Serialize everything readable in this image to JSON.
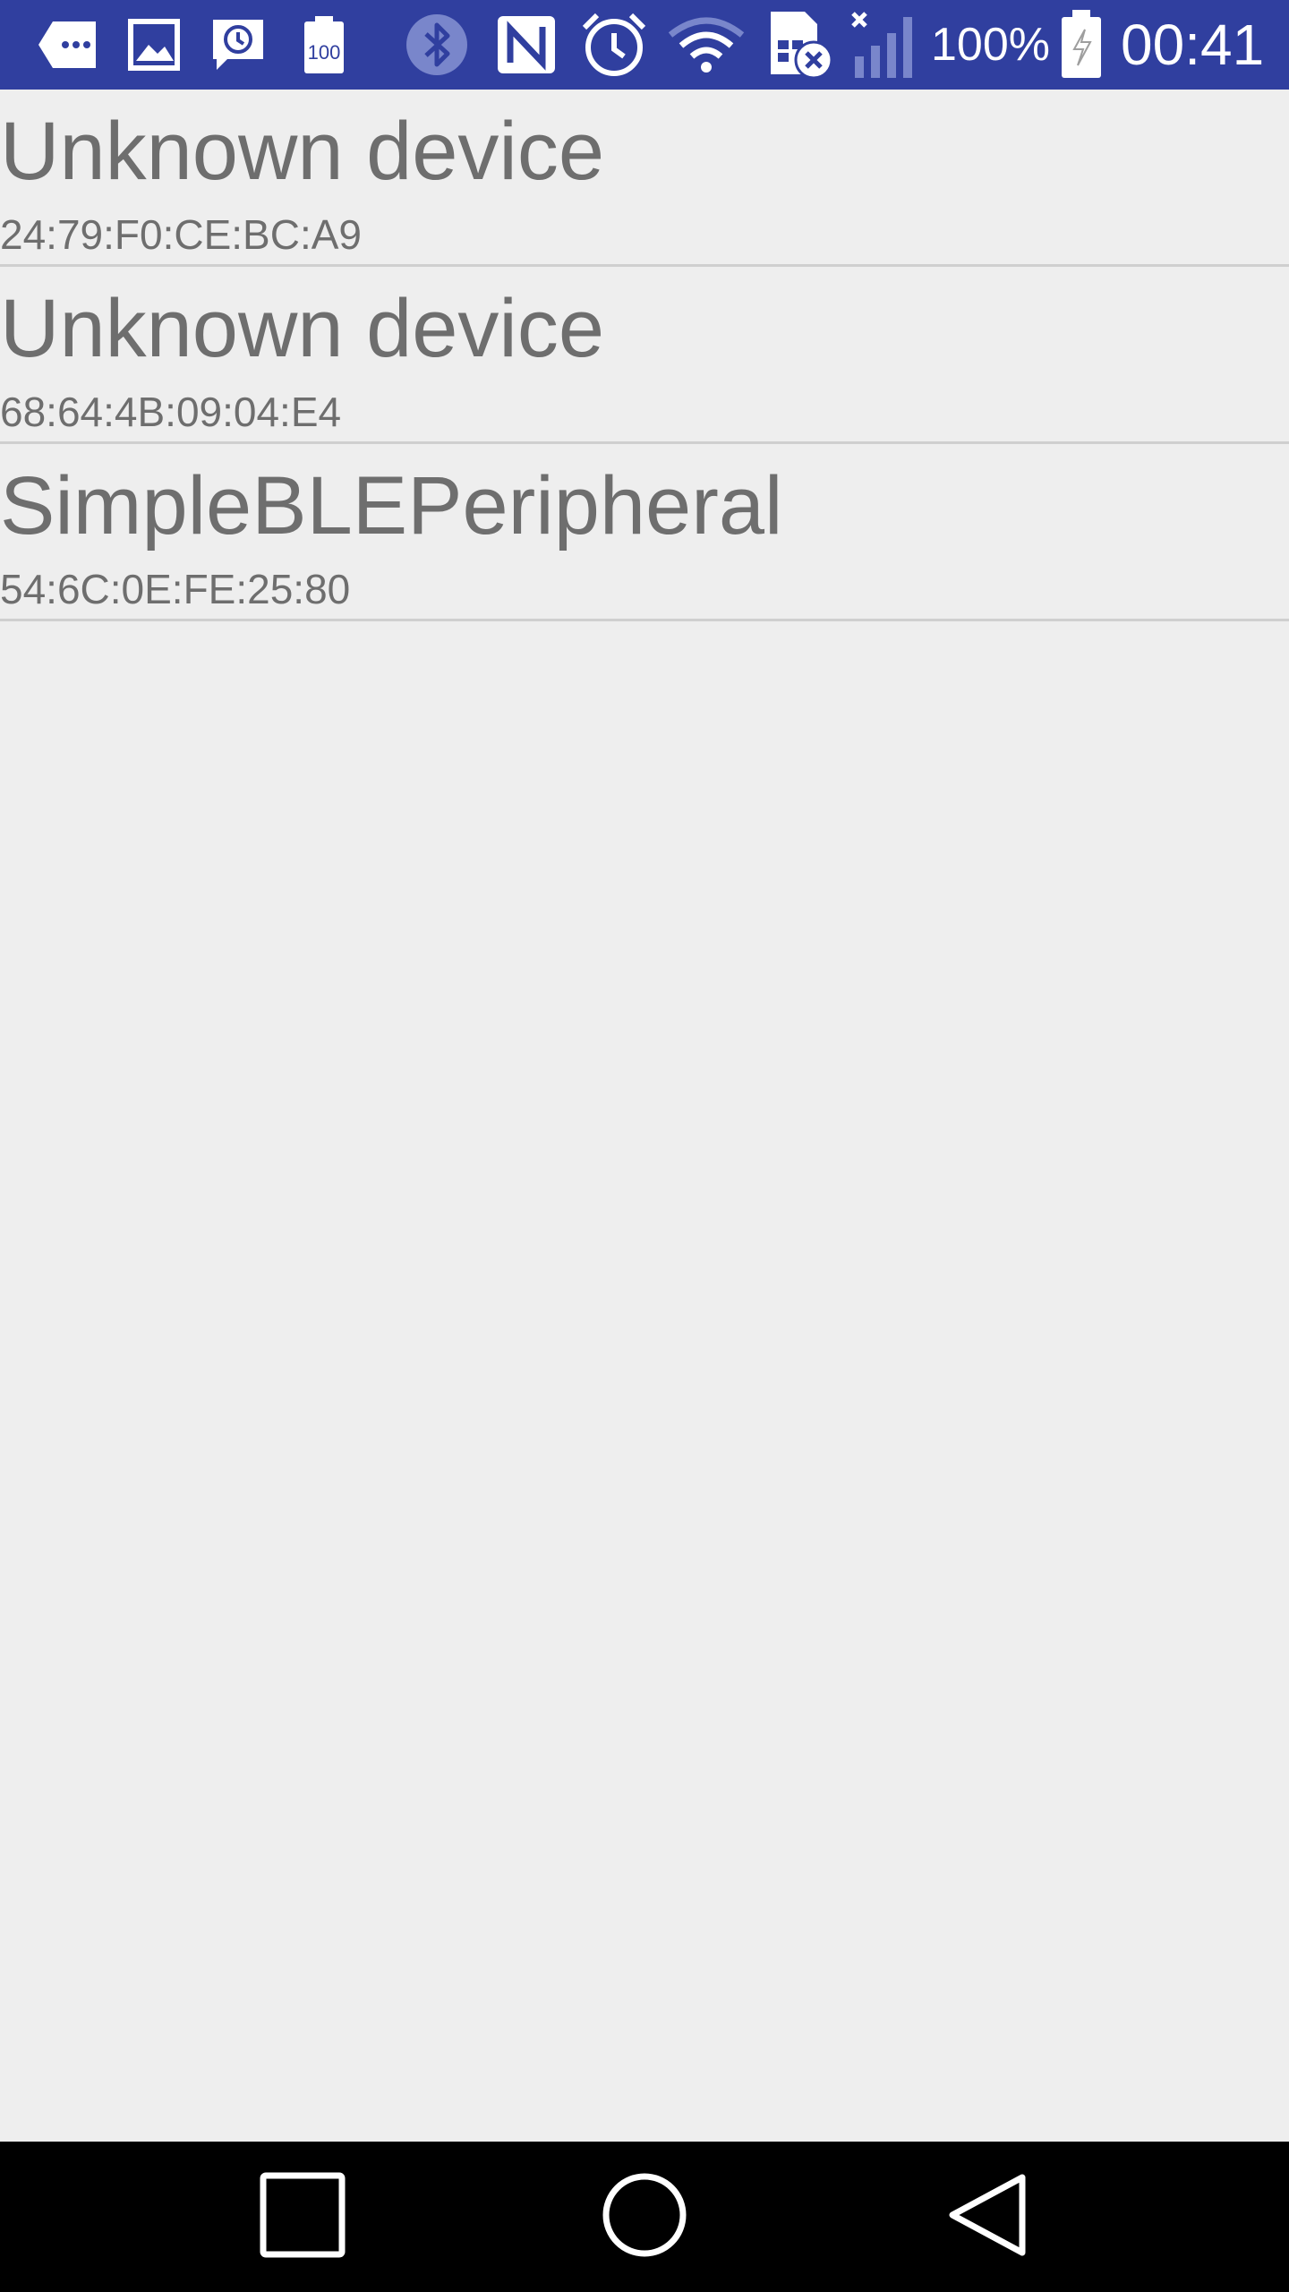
{
  "status_bar": {
    "background": "#303f9f",
    "icons_left": [
      "message-more-icon",
      "image-icon",
      "history-chat-icon",
      "battery-100-icon"
    ],
    "icons_right": [
      "bluetooth-icon",
      "nfc-icon",
      "alarm-icon",
      "wifi-icon",
      "sim-error-icon",
      "signal-icon",
      "battery-charging-icon"
    ],
    "battery_percent": "100%",
    "time": "00:41"
  },
  "devices": [
    {
      "name": "Unknown device",
      "address": "24:79:F0:CE:BC:A9"
    },
    {
      "name": "Unknown device",
      "address": "68:64:4B:09:04:E4"
    },
    {
      "name": "SimpleBLEPeripheral",
      "address": "54:6C:0E:FE:25:80"
    }
  ],
  "nav_bar": {
    "recents": "recents-square-icon",
    "home": "home-circle-icon",
    "back": "back-triangle-icon"
  }
}
